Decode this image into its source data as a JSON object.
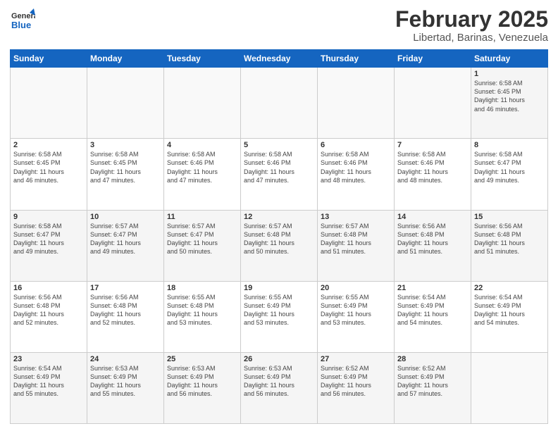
{
  "header": {
    "logo_general": "General",
    "logo_blue": "Blue",
    "month_title": "February 2025",
    "location": "Libertad, Barinas, Venezuela"
  },
  "days_of_week": [
    "Sunday",
    "Monday",
    "Tuesday",
    "Wednesday",
    "Thursday",
    "Friday",
    "Saturday"
  ],
  "weeks": [
    [
      {
        "day": "",
        "info": ""
      },
      {
        "day": "",
        "info": ""
      },
      {
        "day": "",
        "info": ""
      },
      {
        "day": "",
        "info": ""
      },
      {
        "day": "",
        "info": ""
      },
      {
        "day": "",
        "info": ""
      },
      {
        "day": "1",
        "info": "Sunrise: 6:58 AM\nSunset: 6:45 PM\nDaylight: 11 hours\nand 46 minutes."
      }
    ],
    [
      {
        "day": "2",
        "info": "Sunrise: 6:58 AM\nSunset: 6:45 PM\nDaylight: 11 hours\nand 46 minutes."
      },
      {
        "day": "3",
        "info": "Sunrise: 6:58 AM\nSunset: 6:45 PM\nDaylight: 11 hours\nand 47 minutes."
      },
      {
        "day": "4",
        "info": "Sunrise: 6:58 AM\nSunset: 6:46 PM\nDaylight: 11 hours\nand 47 minutes."
      },
      {
        "day": "5",
        "info": "Sunrise: 6:58 AM\nSunset: 6:46 PM\nDaylight: 11 hours\nand 47 minutes."
      },
      {
        "day": "6",
        "info": "Sunrise: 6:58 AM\nSunset: 6:46 PM\nDaylight: 11 hours\nand 48 minutes."
      },
      {
        "day": "7",
        "info": "Sunrise: 6:58 AM\nSunset: 6:46 PM\nDaylight: 11 hours\nand 48 minutes."
      },
      {
        "day": "8",
        "info": "Sunrise: 6:58 AM\nSunset: 6:47 PM\nDaylight: 11 hours\nand 49 minutes."
      }
    ],
    [
      {
        "day": "9",
        "info": "Sunrise: 6:58 AM\nSunset: 6:47 PM\nDaylight: 11 hours\nand 49 minutes."
      },
      {
        "day": "10",
        "info": "Sunrise: 6:57 AM\nSunset: 6:47 PM\nDaylight: 11 hours\nand 49 minutes."
      },
      {
        "day": "11",
        "info": "Sunrise: 6:57 AM\nSunset: 6:47 PM\nDaylight: 11 hours\nand 50 minutes."
      },
      {
        "day": "12",
        "info": "Sunrise: 6:57 AM\nSunset: 6:48 PM\nDaylight: 11 hours\nand 50 minutes."
      },
      {
        "day": "13",
        "info": "Sunrise: 6:57 AM\nSunset: 6:48 PM\nDaylight: 11 hours\nand 51 minutes."
      },
      {
        "day": "14",
        "info": "Sunrise: 6:56 AM\nSunset: 6:48 PM\nDaylight: 11 hours\nand 51 minutes."
      },
      {
        "day": "15",
        "info": "Sunrise: 6:56 AM\nSunset: 6:48 PM\nDaylight: 11 hours\nand 51 minutes."
      }
    ],
    [
      {
        "day": "16",
        "info": "Sunrise: 6:56 AM\nSunset: 6:48 PM\nDaylight: 11 hours\nand 52 minutes."
      },
      {
        "day": "17",
        "info": "Sunrise: 6:56 AM\nSunset: 6:48 PM\nDaylight: 11 hours\nand 52 minutes."
      },
      {
        "day": "18",
        "info": "Sunrise: 6:55 AM\nSunset: 6:48 PM\nDaylight: 11 hours\nand 53 minutes."
      },
      {
        "day": "19",
        "info": "Sunrise: 6:55 AM\nSunset: 6:49 PM\nDaylight: 11 hours\nand 53 minutes."
      },
      {
        "day": "20",
        "info": "Sunrise: 6:55 AM\nSunset: 6:49 PM\nDaylight: 11 hours\nand 53 minutes."
      },
      {
        "day": "21",
        "info": "Sunrise: 6:54 AM\nSunset: 6:49 PM\nDaylight: 11 hours\nand 54 minutes."
      },
      {
        "day": "22",
        "info": "Sunrise: 6:54 AM\nSunset: 6:49 PM\nDaylight: 11 hours\nand 54 minutes."
      }
    ],
    [
      {
        "day": "23",
        "info": "Sunrise: 6:54 AM\nSunset: 6:49 PM\nDaylight: 11 hours\nand 55 minutes."
      },
      {
        "day": "24",
        "info": "Sunrise: 6:53 AM\nSunset: 6:49 PM\nDaylight: 11 hours\nand 55 minutes."
      },
      {
        "day": "25",
        "info": "Sunrise: 6:53 AM\nSunset: 6:49 PM\nDaylight: 11 hours\nand 56 minutes."
      },
      {
        "day": "26",
        "info": "Sunrise: 6:53 AM\nSunset: 6:49 PM\nDaylight: 11 hours\nand 56 minutes."
      },
      {
        "day": "27",
        "info": "Sunrise: 6:52 AM\nSunset: 6:49 PM\nDaylight: 11 hours\nand 56 minutes."
      },
      {
        "day": "28",
        "info": "Sunrise: 6:52 AM\nSunset: 6:49 PM\nDaylight: 11 hours\nand 57 minutes."
      },
      {
        "day": "",
        "info": ""
      }
    ]
  ]
}
